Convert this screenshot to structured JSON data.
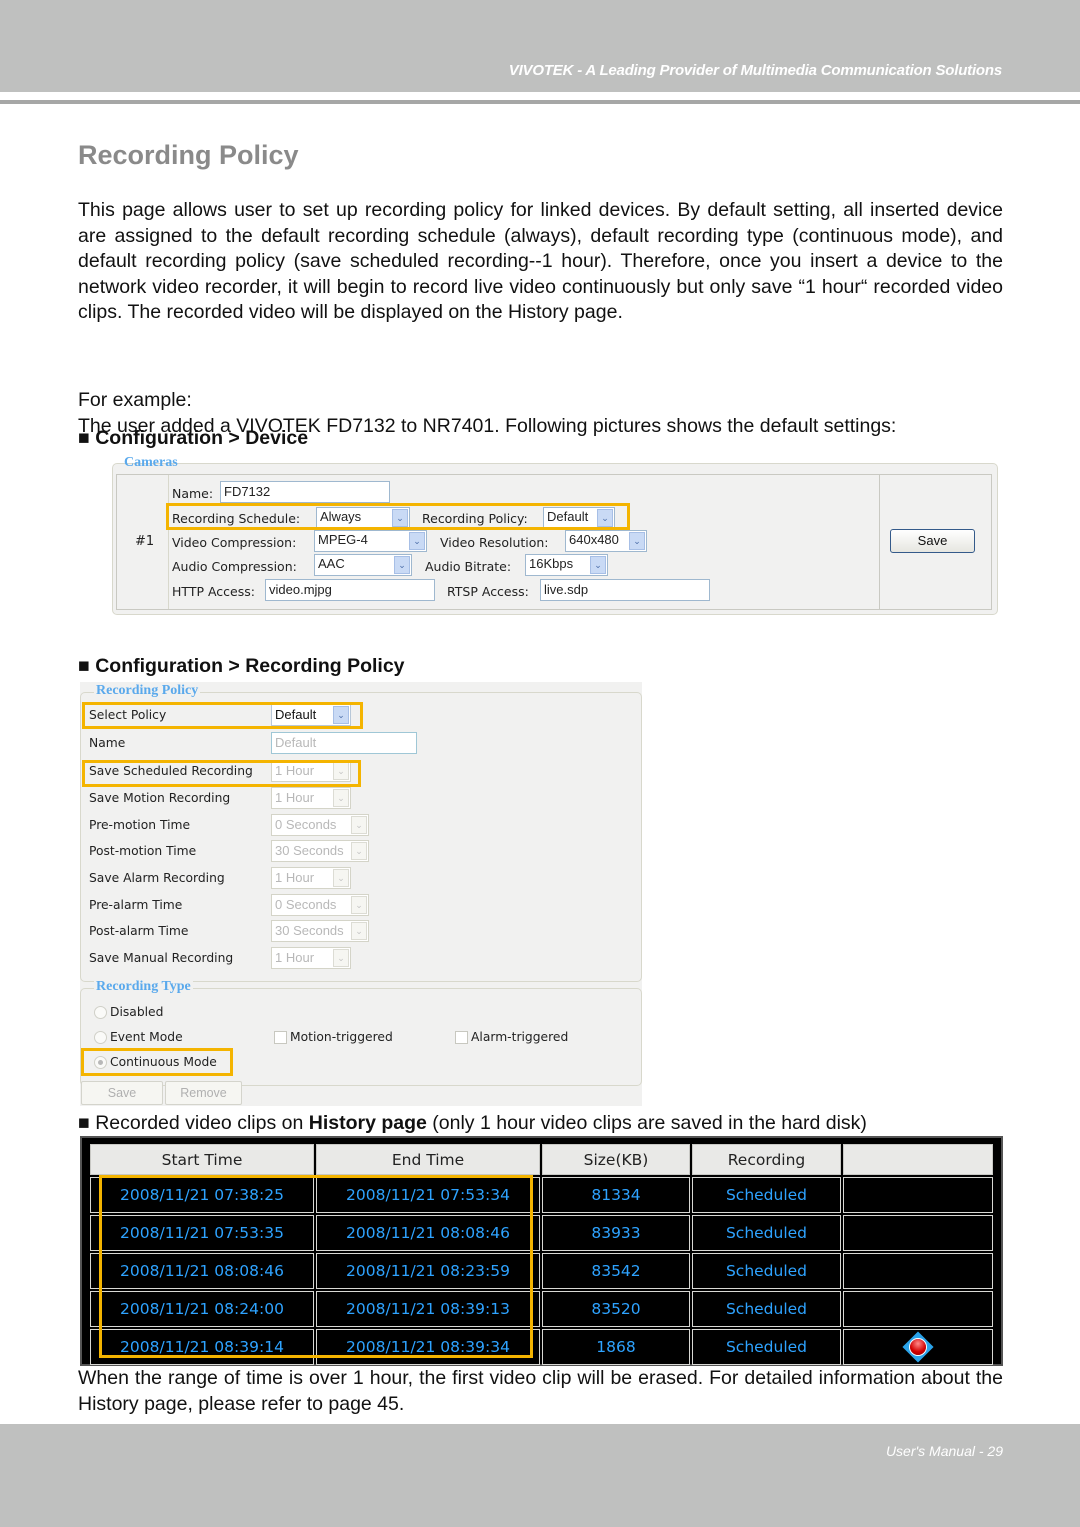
{
  "header": {
    "tagline": "VIVOTEK - A Leading Provider of Multimedia Communication Solutions"
  },
  "page": {
    "title": "Recording Policy",
    "intro": "This page allows user to set up recording policy for linked devices. By default setting, all inserted device are assigned to the default recording schedule (always), default recording type (continuous mode), and default recording policy (save scheduled recording--1 hour). Therefore, once you insert a device to the network video recorder, it will begin to record live video continuously but only save “1 hour“ recorded video clips. The recorded video will be displayed on the History page.",
    "example_label": "For example:",
    "example_text": "The user added a VIVOTEK FD7132 to NR7401. Following pictures shows the default settings:",
    "section_device": "■ Configuration > Device",
    "section_policy": "■ Configuration > Recording Policy",
    "section_history_prefix": "■ Recorded video clips on ",
    "section_history_bold": "History page",
    "section_history_suffix": " (only 1 hour video clips are saved in the hard disk)",
    "closing": "When the range of time is over 1 hour, the first video clip will be erased. For detailed information about the History page, please refer to page 45."
  },
  "device_config": {
    "legend": "Cameras",
    "row_number": "#1",
    "name_label": "Name:",
    "name_value": "FD7132",
    "schedule_label": "Recording Schedule:",
    "schedule_value": "Always",
    "policy_label": "Recording Policy:",
    "policy_value": "Default",
    "video_compression_label": "Video Compression:",
    "video_compression_value": "MPEG-4",
    "video_resolution_label": "Video Resolution:",
    "video_resolution_value": "640x480",
    "audio_compression_label": "Audio Compression:",
    "audio_compression_value": "AAC",
    "audio_bitrate_label": "Audio Bitrate:",
    "audio_bitrate_value": "16Kbps",
    "http_label": "HTTP Access:",
    "http_value": "video.mjpg",
    "rtsp_label": "RTSP Access:",
    "rtsp_value": "live.sdp",
    "save_label": "Save",
    "dropdown_arrow": "⌄"
  },
  "policy_config": {
    "legend": "Recording Policy",
    "rows": [
      {
        "label": "Select Policy",
        "value": "Default"
      },
      {
        "label": "Name",
        "value": "Default"
      },
      {
        "label": "Save Scheduled Recording",
        "value": "1 Hour"
      },
      {
        "label": "Save Motion Recording",
        "value": "1 Hour"
      },
      {
        "label": "Pre-motion Time",
        "value": "0 Seconds"
      },
      {
        "label": "Post-motion Time",
        "value": "30 Seconds"
      },
      {
        "label": "Save Alarm Recording",
        "value": "1 Hour"
      },
      {
        "label": "Pre-alarm Time",
        "value": "0 Seconds"
      },
      {
        "label": "Post-alarm Time",
        "value": "30 Seconds"
      },
      {
        "label": "Save Manual Recording",
        "value": "1 Hour"
      }
    ],
    "type_legend": "Recording Type",
    "type_options": {
      "disabled": "Disabled",
      "event": "Event Mode",
      "continuous": "Continuous Mode",
      "selected": "Continuous Mode"
    },
    "event_checkboxes": {
      "motion": "Motion-triggered",
      "alarm": "Alarm-triggered"
    },
    "save_label": "Save",
    "remove_label": "Remove"
  },
  "history": {
    "columns": [
      "Start Time",
      "End Time",
      "Size(KB)",
      "Recording",
      ""
    ],
    "rows": [
      {
        "start": "2008/11/21 07:38:25",
        "end": "2008/11/21 07:53:34",
        "size": "81334",
        "recording": "Scheduled",
        "icon": ""
      },
      {
        "start": "2008/11/21 07:53:35",
        "end": "2008/11/21 08:08:46",
        "size": "83933",
        "recording": "Scheduled",
        "icon": ""
      },
      {
        "start": "2008/11/21 08:08:46",
        "end": "2008/11/21 08:23:59",
        "size": "83542",
        "recording": "Scheduled",
        "icon": ""
      },
      {
        "start": "2008/11/21 08:24:00",
        "end": "2008/11/21 08:39:13",
        "size": "83520",
        "recording": "Scheduled",
        "icon": ""
      },
      {
        "start": "2008/11/21 08:39:14",
        "end": "2008/11/21 08:39:34",
        "size": "1868",
        "recording": "Scheduled",
        "icon": "recording-active-icon"
      }
    ]
  },
  "footer": {
    "page_label": "User's Manual - 29"
  },
  "colors": {
    "band_gray": "#bfc0bf",
    "title_gray": "#8a8a8a",
    "highlight_orange": "#f4b400",
    "legend_blue": "#5aa9ec",
    "history_text_blue": "#2ea3ff"
  }
}
